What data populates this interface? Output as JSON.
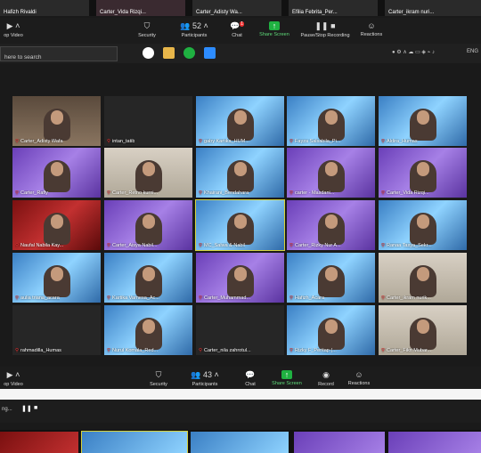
{
  "top_strip": {
    "names": [
      "Hafizh Rivaldi",
      "Carter_Vida Rizqi...",
      "Carter_Adisty Wa...",
      "Efilia Febrita_Per...",
      "Carter_ikram nuri..."
    ]
  },
  "toolbar_top": {
    "video_label": "op Video",
    "security_label": "Security",
    "participants_label": "Participants",
    "participants_count": "52",
    "chat_label": "Chat",
    "chat_badge": "1",
    "share_label": "Share Screen",
    "record_label": "Pause/Stop Recording",
    "reactions_label": "Reactions"
  },
  "taskbar": {
    "search_placeholder": "here to search",
    "lang": "ENG"
  },
  "tiles": [
    {
      "name": "Carter_Adisty Wafa",
      "bg": "room"
    },
    {
      "name": "intan_tatib",
      "bg": "dark"
    },
    {
      "name": "gaby Kartika_HUM...",
      "bg": "blue"
    },
    {
      "name": "Fayza Salsabila_Pi...",
      "bg": "blue"
    },
    {
      "name": "Aldira_Humas",
      "bg": "blue"
    },
    {
      "name": "Carter_Rafly",
      "bg": "purple"
    },
    {
      "name": "Carter_Retno kurni...",
      "bg": "light"
    },
    {
      "name": "Khairani_Bendahara",
      "bg": "blue"
    },
    {
      "name": "carter - Masdani...",
      "bg": "purple"
    },
    {
      "name": "Carter_Vida Rizqi...",
      "bg": "purple"
    },
    {
      "name": "Naufal Nabila Kay...",
      "bg": "red"
    },
    {
      "name": "Carter_Aisya Nabil...",
      "bg": "purple"
    },
    {
      "name": "MC_Salwa & Nabil",
      "bg": "blue"
    },
    {
      "name": "Carter_Rizky Nur A...",
      "bg": "purple"
    },
    {
      "name": "Ranaa Tasya_Sekr...",
      "bg": "blue"
    },
    {
      "name": "aulia triana_acara",
      "bg": "blue"
    },
    {
      "name": "Kartika Varnesa_Ac...",
      "bg": "blue"
    },
    {
      "name": "Carter_Muhammad...",
      "bg": "purple"
    },
    {
      "name": "Hafizh_Acara",
      "bg": "blue"
    },
    {
      "name": "Carter_ikram nurik...",
      "bg": "light"
    },
    {
      "name": "rahmadilla_Humas",
      "bg": "dark"
    },
    {
      "name": "Nurul Komala_Red...",
      "bg": "blue"
    },
    {
      "name": "Carter_nila zahrotul...",
      "bg": "dark"
    },
    {
      "name": "Rizky F_Peritap (...",
      "bg": "blue"
    },
    {
      "name": "Carter_Fikri Mubar...",
      "bg": "light"
    }
  ],
  "toolbar_bottom": {
    "video_label": "op Video",
    "security_label": "Security",
    "participants_label": "Participants",
    "participants_count": "43",
    "chat_label": "Chat",
    "share_label": "Share Screen",
    "record_label": "Record",
    "reactions_label": "Reactions"
  },
  "bottom_bar": {
    "status": "ng..."
  },
  "colors": {
    "share_green": "#1fb141",
    "mic_red": "#e33333",
    "highlight_yellow": "#d6d23c"
  }
}
